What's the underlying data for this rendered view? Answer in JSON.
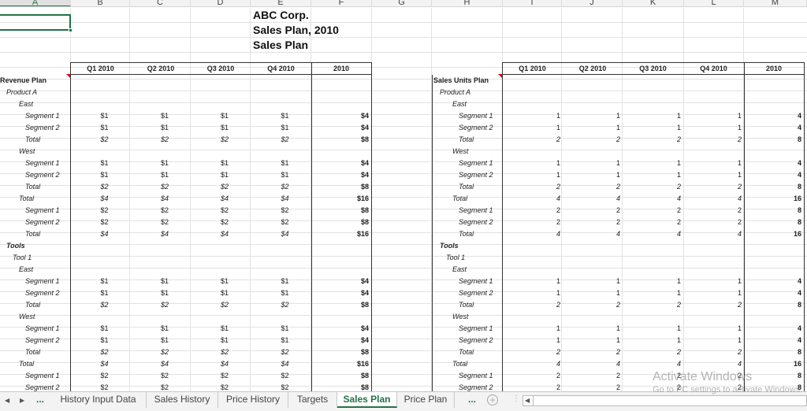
{
  "columns": [
    "A",
    "B",
    "C",
    "D",
    "E",
    "F",
    "G",
    "H",
    "I",
    "J",
    "K",
    "L",
    "M"
  ],
  "selected_column": "A",
  "titles": [
    "ABC Corp.",
    "Sales Plan, 2010",
    "Sales Plan"
  ],
  "period_headers": [
    "Q1 2010",
    "Q2 2010",
    "Q3 2010",
    "Q4 2010",
    "2010"
  ],
  "revenue_plan": {
    "heading": "Revenue Plan",
    "rows": [
      {
        "label": "Product A",
        "style": "it",
        "indent": 1,
        "values": []
      },
      {
        "label": "East",
        "style": "it",
        "indent": 2,
        "values": []
      },
      {
        "label": "Segment 1",
        "style": "it",
        "indent": 3,
        "values": [
          "$1",
          "$1",
          "$1",
          "$1",
          "$4"
        ]
      },
      {
        "label": "Segment 2",
        "style": "it",
        "indent": 3,
        "values": [
          "$1",
          "$1",
          "$1",
          "$1",
          "$4"
        ]
      },
      {
        "label": "Total",
        "style": "it",
        "indent": 3,
        "values": [
          "$2",
          "$2",
          "$2",
          "$2",
          "$8"
        ]
      },
      {
        "label": "West",
        "style": "it",
        "indent": 2,
        "values": []
      },
      {
        "label": "Segment 1",
        "style": "it",
        "indent": 3,
        "values": [
          "$1",
          "$1",
          "$1",
          "$1",
          "$4"
        ]
      },
      {
        "label": "Segment 2",
        "style": "it",
        "indent": 3,
        "values": [
          "$1",
          "$1",
          "$1",
          "$1",
          "$4"
        ]
      },
      {
        "label": "Total",
        "style": "it",
        "indent": 3,
        "values": [
          "$2",
          "$2",
          "$2",
          "$2",
          "$8"
        ]
      },
      {
        "label": "Total",
        "style": "it",
        "indent": 2,
        "values": [
          "$4",
          "$4",
          "$4",
          "$4",
          "$16"
        ]
      },
      {
        "label": "Segment 1",
        "style": "it",
        "indent": 3,
        "values": [
          "$2",
          "$2",
          "$2",
          "$2",
          "$8"
        ]
      },
      {
        "label": "Segment 2",
        "style": "it",
        "indent": 3,
        "values": [
          "$2",
          "$2",
          "$2",
          "$2",
          "$8"
        ]
      },
      {
        "label": "Total",
        "style": "it",
        "indent": 3,
        "values": [
          "$4",
          "$4",
          "$4",
          "$4",
          "$16"
        ]
      },
      {
        "label": "Tools",
        "style": "bi",
        "indent": 1,
        "values": []
      },
      {
        "label": "Tool 1",
        "style": "it",
        "indent": 1.5,
        "values": []
      },
      {
        "label": "East",
        "style": "it",
        "indent": 2,
        "values": []
      },
      {
        "label": "Segment 1",
        "style": "it",
        "indent": 3,
        "values": [
          "$1",
          "$1",
          "$1",
          "$1",
          "$4"
        ]
      },
      {
        "label": "Segment 2",
        "style": "it",
        "indent": 3,
        "values": [
          "$1",
          "$1",
          "$1",
          "$1",
          "$4"
        ]
      },
      {
        "label": "Total",
        "style": "it",
        "indent": 3,
        "values": [
          "$2",
          "$2",
          "$2",
          "$2",
          "$8"
        ]
      },
      {
        "label": "West",
        "style": "it",
        "indent": 2,
        "values": []
      },
      {
        "label": "Segment 1",
        "style": "it",
        "indent": 3,
        "values": [
          "$1",
          "$1",
          "$1",
          "$1",
          "$4"
        ]
      },
      {
        "label": "Segment 2",
        "style": "it",
        "indent": 3,
        "values": [
          "$1",
          "$1",
          "$1",
          "$1",
          "$4"
        ]
      },
      {
        "label": "Total",
        "style": "it",
        "indent": 3,
        "values": [
          "$2",
          "$2",
          "$2",
          "$2",
          "$8"
        ]
      },
      {
        "label": "Total",
        "style": "it",
        "indent": 2,
        "values": [
          "$4",
          "$4",
          "$4",
          "$4",
          "$16"
        ]
      },
      {
        "label": "Segment 1",
        "style": "it",
        "indent": 3,
        "values": [
          "$2",
          "$2",
          "$2",
          "$2",
          "$8"
        ]
      },
      {
        "label": "Segment 2",
        "style": "it",
        "indent": 3,
        "values": [
          "$2",
          "$2",
          "$2",
          "$2",
          "$8"
        ]
      }
    ]
  },
  "units_plan": {
    "heading": "Sales Units Plan",
    "rows": [
      {
        "label": "Product A",
        "style": "it",
        "indent": 1,
        "values": []
      },
      {
        "label": "East",
        "style": "it",
        "indent": 2,
        "values": []
      },
      {
        "label": "Segment 1",
        "style": "it",
        "indent": 3,
        "values": [
          "1",
          "1",
          "1",
          "1",
          "4"
        ]
      },
      {
        "label": "Segment 2",
        "style": "it",
        "indent": 3,
        "values": [
          "1",
          "1",
          "1",
          "1",
          "4"
        ]
      },
      {
        "label": "Total",
        "style": "it",
        "indent": 3,
        "values": [
          "2",
          "2",
          "2",
          "2",
          "8"
        ]
      },
      {
        "label": "West",
        "style": "it",
        "indent": 2,
        "values": []
      },
      {
        "label": "Segment 1",
        "style": "it",
        "indent": 3,
        "values": [
          "1",
          "1",
          "1",
          "1",
          "4"
        ]
      },
      {
        "label": "Segment 2",
        "style": "it",
        "indent": 3,
        "values": [
          "1",
          "1",
          "1",
          "1",
          "4"
        ]
      },
      {
        "label": "Total",
        "style": "it",
        "indent": 3,
        "values": [
          "2",
          "2",
          "2",
          "2",
          "8"
        ]
      },
      {
        "label": "Total",
        "style": "it",
        "indent": 2,
        "values": [
          "4",
          "4",
          "4",
          "4",
          "16"
        ]
      },
      {
        "label": "Segment 1",
        "style": "it",
        "indent": 3,
        "values": [
          "2",
          "2",
          "2",
          "2",
          "8"
        ]
      },
      {
        "label": "Segment 2",
        "style": "it",
        "indent": 3,
        "values": [
          "2",
          "2",
          "2",
          "2",
          "8"
        ]
      },
      {
        "label": "Total",
        "style": "it",
        "indent": 3,
        "values": [
          "4",
          "4",
          "4",
          "4",
          "16"
        ]
      },
      {
        "label": "Tools",
        "style": "bi",
        "indent": 1,
        "values": []
      },
      {
        "label": "Tool 1",
        "style": "it",
        "indent": 1.5,
        "values": []
      },
      {
        "label": "East",
        "style": "it",
        "indent": 2,
        "values": []
      },
      {
        "label": "Segment 1",
        "style": "it",
        "indent": 3,
        "values": [
          "1",
          "1",
          "1",
          "1",
          "4"
        ]
      },
      {
        "label": "Segment 2",
        "style": "it",
        "indent": 3,
        "values": [
          "1",
          "1",
          "1",
          "1",
          "4"
        ]
      },
      {
        "label": "Total",
        "style": "it",
        "indent": 3,
        "values": [
          "2",
          "2",
          "2",
          "2",
          "8"
        ]
      },
      {
        "label": "West",
        "style": "it",
        "indent": 2,
        "values": []
      },
      {
        "label": "Segment 1",
        "style": "it",
        "indent": 3,
        "values": [
          "1",
          "1",
          "1",
          "1",
          "4"
        ]
      },
      {
        "label": "Segment 2",
        "style": "it",
        "indent": 3,
        "values": [
          "1",
          "1",
          "1",
          "1",
          "4"
        ]
      },
      {
        "label": "Total",
        "style": "it",
        "indent": 3,
        "values": [
          "2",
          "2",
          "2",
          "2",
          "8"
        ]
      },
      {
        "label": "Total",
        "style": "it",
        "indent": 2,
        "values": [
          "4",
          "4",
          "4",
          "4",
          "16"
        ]
      },
      {
        "label": "Segment 1",
        "style": "it",
        "indent": 3,
        "values": [
          "2",
          "2",
          "2",
          "2",
          "8"
        ]
      },
      {
        "label": "Segment 2",
        "style": "it",
        "indent": 3,
        "values": [
          "2",
          "2",
          "2",
          "2",
          "8"
        ]
      }
    ]
  },
  "sheet_tabs": {
    "prev_icon": "triangle-left-icon",
    "next_icon": "triangle-right-icon",
    "more_left": "...",
    "tabs": [
      {
        "label": "History Input Data",
        "active": false
      },
      {
        "label": "Sales History",
        "active": false
      },
      {
        "label": "Price History",
        "active": false
      },
      {
        "label": "Targets",
        "active": false
      },
      {
        "label": "Sales Plan",
        "active": true
      },
      {
        "label": "Price Plan",
        "active": false
      }
    ],
    "more_right": "...",
    "add_sheet": "+"
  },
  "watermark": {
    "line1": "Activate Windows",
    "line2": "Go to PC settings to activate Windows."
  },
  "accent_color": "#217346"
}
